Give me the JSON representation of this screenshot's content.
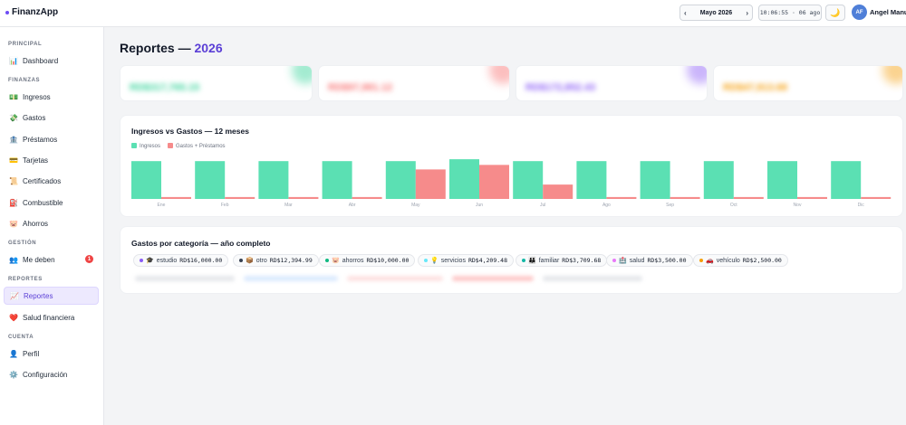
{
  "app": {
    "name": "FinanzApp"
  },
  "header": {
    "month": "Mayo 2026",
    "prev": "‹",
    "next": "›",
    "clock": "10:06:55 · 06 ago",
    "theme_icon": "🌙",
    "avatar_initials": "AF",
    "user_name": "Angel Manuel"
  },
  "sidebar": {
    "sections": [
      {
        "label": "PRINCIPAL"
      },
      {
        "label": "FINANZAS"
      },
      {
        "label": "GESTIÓN"
      },
      {
        "label": "REPORTES"
      },
      {
        "label": "CUENTA"
      }
    ],
    "items": [
      {
        "label": "Dashboard",
        "icon": "📊",
        "icon_name": "chart-icon"
      },
      {
        "label": "Ingresos",
        "icon": "💵",
        "icon_name": "cash-icon"
      },
      {
        "label": "Gastos",
        "icon": "💸",
        "icon_name": "money-wings-icon"
      },
      {
        "label": "Préstamos",
        "icon": "🏦",
        "icon_name": "bank-icon"
      },
      {
        "label": "Tarjetas",
        "icon": "💳",
        "icon_name": "credit-card-icon"
      },
      {
        "label": "Certificados",
        "icon": "📜",
        "icon_name": "scroll-icon"
      },
      {
        "label": "Combustible",
        "icon": "⛽",
        "icon_name": "fuel-icon"
      },
      {
        "label": "Ahorros",
        "icon": "🐷",
        "icon_name": "piggy-bank-icon"
      },
      {
        "label": "Me deben",
        "icon": "👥",
        "icon_name": "people-icon",
        "badge": "1"
      },
      {
        "label": "Reportes",
        "icon": "📈",
        "icon_name": "trend-icon",
        "active": true
      },
      {
        "label": "Salud financiera",
        "icon": "❤️",
        "icon_name": "heart-icon"
      },
      {
        "label": "Perfil",
        "icon": "👤",
        "icon_name": "user-icon"
      },
      {
        "label": "Configuración",
        "icon": "⚙️",
        "icon_name": "gear-icon"
      }
    ]
  },
  "page": {
    "title": "Reportes — ",
    "year": "2026"
  },
  "stats": [
    {
      "value": "RD$317,765.15",
      "color": "#34d399"
    },
    {
      "value": "RD$97,981.12",
      "color": "#f87171"
    },
    {
      "value": "RD$172,852.43",
      "color": "#8b5cf6"
    },
    {
      "value": "RD$47,913.68",
      "color": "#f59e0b"
    }
  ],
  "chart_card": {
    "title": "Ingresos vs Gastos — 12 meses"
  },
  "chart_data": {
    "type": "bar",
    "categories": [
      "Ene",
      "Feb",
      "Mar",
      "Abr",
      "May",
      "Jun",
      "Jul",
      "Ago",
      "Sep",
      "Oct",
      "Nov",
      "Dic"
    ],
    "series": [
      {
        "name": "Ingresos",
        "color": "#5be0b3",
        "values": [
          100,
          100,
          100,
          100,
          100,
          105,
          100,
          100,
          100,
          100,
          100,
          100
        ]
      },
      {
        "name": "Gastos + Préstamos",
        "color": "#f68b8b",
        "values": [
          5,
          5,
          5,
          5,
          78,
          90,
          38,
          5,
          5,
          5,
          5,
          5
        ]
      }
    ],
    "ylim": [
      0,
      110
    ]
  },
  "categories_card": {
    "title": "Gastos por categoría — año completo",
    "chips": [
      {
        "icon": "🎓",
        "label": "estudio",
        "amount": "RD$16,000.00",
        "color": "#8b5cf6"
      },
      {
        "icon": "📦",
        "label": "otro",
        "amount": "RD$12,394.99",
        "color": "#374151"
      },
      {
        "icon": "🐷",
        "label": "ahorros",
        "amount": "RD$10,000.00",
        "color": "#10b981"
      },
      {
        "icon": "💡",
        "label": "servicios",
        "amount": "RD$4,209.48",
        "color": "#67e8f9"
      },
      {
        "icon": "👪",
        "label": "familiar",
        "amount": "RD$3,709.68",
        "color": "#14b8a6"
      },
      {
        "icon": "🏥",
        "label": "salud",
        "amount": "RD$3,500.00",
        "color": "#e879f9"
      },
      {
        "icon": "🚗",
        "label": "vehículo",
        "amount": "RD$2,500.00",
        "color": "#f59e0b"
      }
    ]
  }
}
